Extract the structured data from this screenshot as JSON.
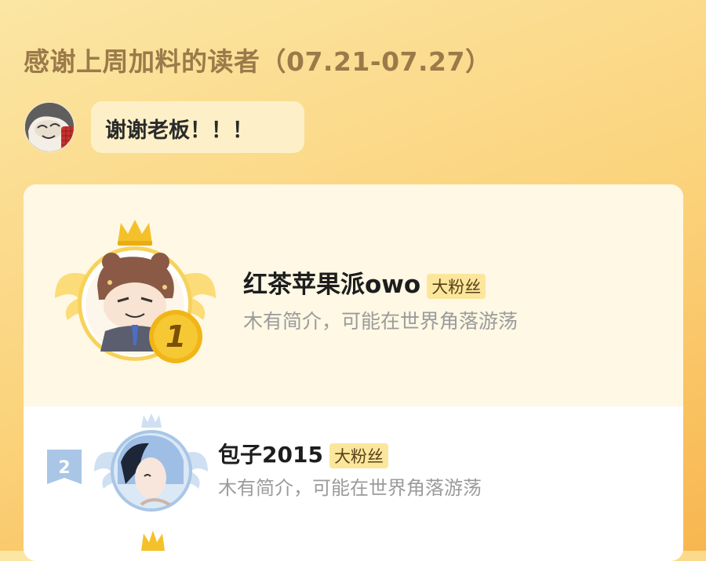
{
  "header": {
    "title": "感谢上周加料的读者（07.21-07.27）"
  },
  "message": {
    "text": "谢谢老板！！！"
  },
  "ranking": [
    {
      "rank": "1",
      "name": "红茶苹果派owo",
      "badge": "大粉丝",
      "bio": "木有简介，可能在世界角落游荡"
    },
    {
      "rank": "2",
      "name": "包子2015",
      "badge": "大粉丝",
      "bio": "木有简介，可能在世界角落游荡"
    }
  ],
  "colors": {
    "gold": "#f5c12a",
    "badge_bg": "#fbe79c",
    "title": "#9b7a4a",
    "silver": "#a9c6e6"
  }
}
